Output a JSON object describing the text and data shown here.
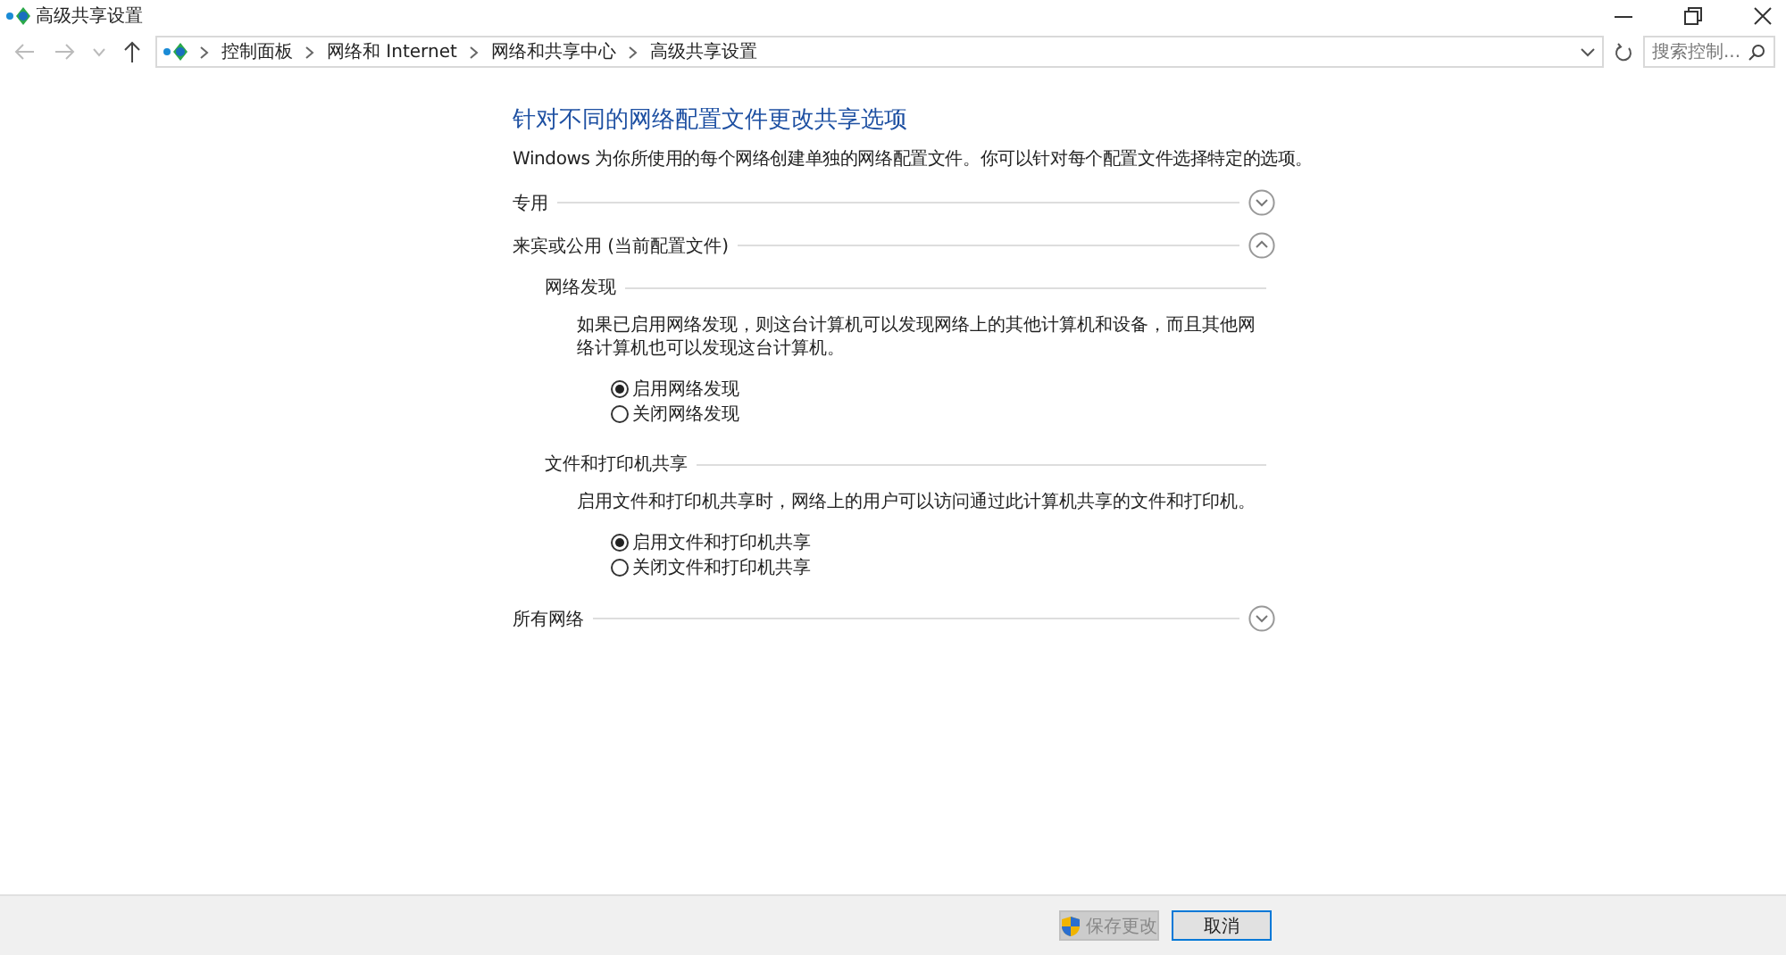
{
  "window": {
    "title": "高级共享设置"
  },
  "address_bar": {
    "breadcrumbs": [
      "控制面板",
      "网络和 Internet",
      "网络和共享中心",
      "高级共享设置"
    ],
    "search_placeholder": "搜索控制..."
  },
  "heading": "针对不同的网络配置文件更改共享选项",
  "intro": "Windows 为你所使用的每个网络创建单独的网络配置文件。你可以针对每个配置文件选择特定的选项。",
  "profiles": [
    {
      "name": "专用",
      "expanded": false
    },
    {
      "name": "来宾或公用 (当前配置文件)",
      "expanded": true,
      "groups": [
        {
          "title": "网络发现",
          "description": "如果已启用网络发现，则这台计算机可以发现网络上的其他计算机和设备，而且其他网络计算机也可以发现这台计算机。",
          "options": [
            {
              "label": "启用网络发现",
              "selected": true
            },
            {
              "label": "关闭网络发现",
              "selected": false
            }
          ]
        },
        {
          "title": "文件和打印机共享",
          "description": "启用文件和打印机共享时，网络上的用户可以访问通过此计算机共享的文件和打印机。",
          "options": [
            {
              "label": "启用文件和打印机共享",
              "selected": true
            },
            {
              "label": "关闭文件和打印机共享",
              "selected": false
            }
          ]
        }
      ]
    },
    {
      "name": "所有网络",
      "expanded": false
    }
  ],
  "buttons": [
    {
      "label": "保存更改",
      "kind": "shield",
      "disabled": true
    },
    {
      "label": "取消",
      "kind": "plain",
      "disabled": false
    }
  ]
}
